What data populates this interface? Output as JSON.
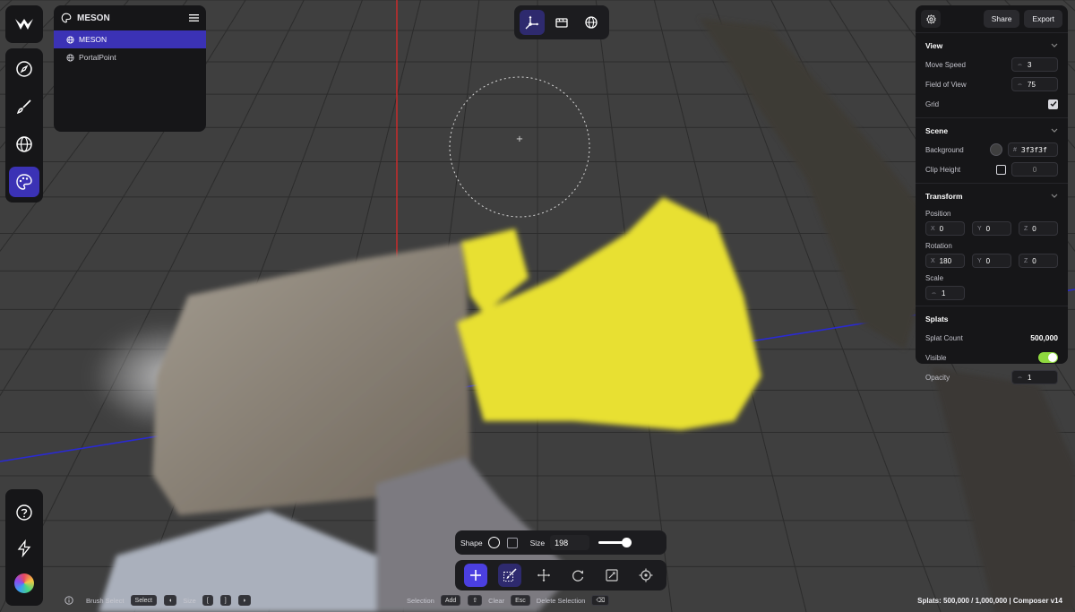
{
  "colors": {
    "accent": "#3b32b5",
    "panel": "#161618",
    "splat_highlight": "#e8e032",
    "toggle_on": "#8fd93f",
    "grid_bg": "#3f3f3f"
  },
  "sidebar": {
    "tools": [
      {
        "name": "compass-icon"
      },
      {
        "name": "brush-icon"
      },
      {
        "name": "globe-icon"
      },
      {
        "name": "palette-icon",
        "active": true
      }
    ],
    "bottom": [
      {
        "name": "help-icon"
      },
      {
        "name": "lightning-icon"
      }
    ]
  },
  "outliner": {
    "title": "MESON",
    "items": [
      {
        "label": "MESON",
        "selected": true
      },
      {
        "label": "PortalPoint",
        "selected": false
      }
    ]
  },
  "top_toolbar": {
    "buttons": [
      "transform-gizmo-icon",
      "camera-icon",
      "sphere-icon"
    ]
  },
  "right_panel": {
    "share_label": "Share",
    "export_label": "Export",
    "view": {
      "title": "View",
      "move_speed_label": "Move Speed",
      "move_speed": "3",
      "fov_label": "Field of View",
      "fov": "75",
      "grid_label": "Grid",
      "grid_checked": true
    },
    "scene": {
      "title": "Scene",
      "background_label": "Background",
      "background_hash": "#",
      "background_value": "3f3f3f",
      "clip_height_label": "Clip Height",
      "clip_height": "0"
    },
    "transform": {
      "title": "Transform",
      "position_label": "Position",
      "position": {
        "x": "0",
        "y": "0",
        "z": "0"
      },
      "rotation_label": "Rotation",
      "rotation": {
        "x": "180",
        "y": "0",
        "z": "0"
      },
      "scale_label": "Scale",
      "scale": "1",
      "axis_x": "X",
      "axis_y": "Y",
      "axis_z": "Z"
    },
    "splats": {
      "title": "Splats",
      "count_label": "Splat Count",
      "count": "500,000",
      "visible_label": "Visible",
      "visible": true,
      "opacity_label": "Opacity",
      "opacity": "1"
    }
  },
  "brush": {
    "shape_label": "Shape",
    "size_label": "Size",
    "size": "198",
    "size_fraction": 0.85
  },
  "status": {
    "brush_select": "Brush Select",
    "select": "Select",
    "size": "Size",
    "key_left_bracket": "[",
    "key_right_bracket": "]",
    "selection": "Selection",
    "add": "Add",
    "clear": "Clear",
    "esc": "Esc",
    "delete_selection": "Delete Selection",
    "right": "Splats: 500,000 / 1,000,000 | Composer v14"
  }
}
